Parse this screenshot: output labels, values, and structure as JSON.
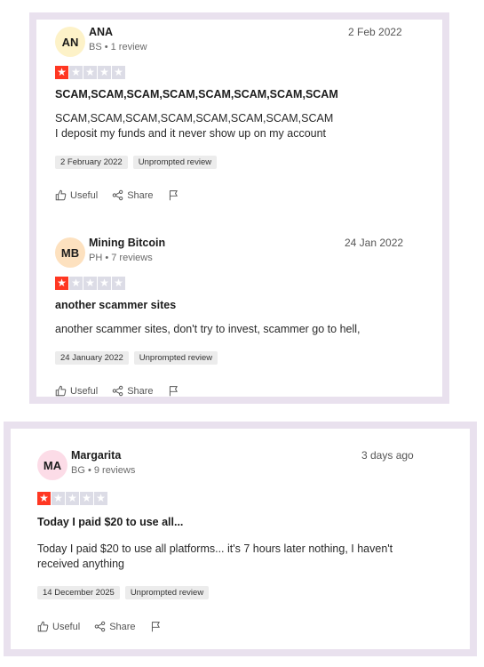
{
  "reviews": [
    {
      "initials": "AN",
      "avatar_color": "#fdf2c8",
      "author": "ANA",
      "meta": "BS • 1 review",
      "date": "2 Feb 2022",
      "rating": 1,
      "title": "SCAM,SCAM,SCAM,SCAM,SCAM,SCAM,SCAM,SCAM",
      "body": [
        "SCAM,SCAM,SCAM,SCAM,SCAM,SCAM,SCAM,SCAM",
        "I deposit my funds and it never show up on my account"
      ],
      "experience_date": "2 February 2022",
      "tag": "Unprompted review",
      "useful_label": "Useful",
      "share_label": "Share"
    },
    {
      "initials": "MB",
      "avatar_color": "#fde1bf",
      "author": "Mining Bitcoin",
      "meta": "PH • 7 reviews",
      "date": "24 Jan 2022",
      "rating": 1,
      "title": "another scammer sites",
      "body": [
        "another scammer sites, don't try to invest, scammer go to hell,"
      ],
      "experience_date": "24 January 2022",
      "tag": "Unprompted review",
      "useful_label": "Useful",
      "share_label": "Share"
    },
    {
      "initials": "MA",
      "avatar_color": "#fcdce7",
      "author": "Margarita",
      "meta": "BG • 9 reviews",
      "date": "3 days ago",
      "rating": 1,
      "title": "Today I paid $20 to use all...",
      "body": [
        "Today I paid $20 to use all platforms... it's 7 hours later nothing, I haven't received anything"
      ],
      "experience_date": "14 December 2025",
      "tag": "Unprompted review",
      "useful_label": "Useful",
      "share_label": "Share"
    }
  ],
  "colors": {
    "star_filled": "#ff3722",
    "star_empty": "#dcdce6",
    "panel_border": "#e9e1ee"
  }
}
